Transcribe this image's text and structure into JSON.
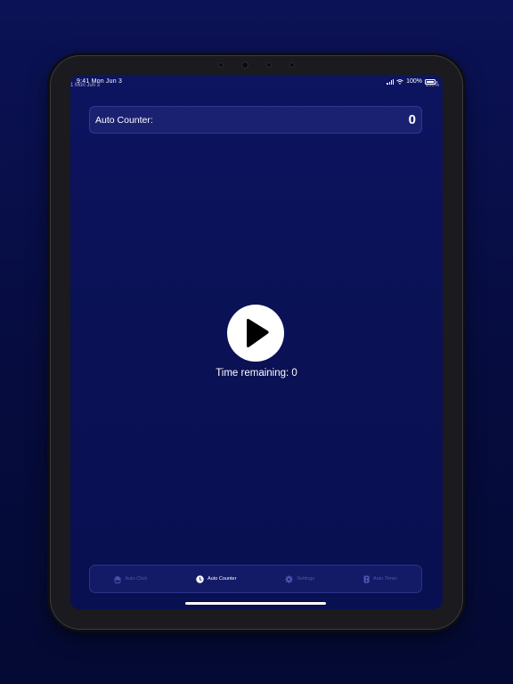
{
  "status_bar": {
    "time_date": "9:41 Mon Jun 3",
    "ghost_date": "1 Mon Jun 3",
    "battery": "100%"
  },
  "counter": {
    "label": "Auto Counter:",
    "value": "0"
  },
  "play": {
    "icon": "play-icon"
  },
  "timer": {
    "text": "Time remaining: 0"
  },
  "tabs": [
    {
      "label": "Auto Click",
      "icon": "hand-tap-icon",
      "active": false
    },
    {
      "label": "Auto Counter",
      "icon": "clock-icon",
      "active": true
    },
    {
      "label": "Settings",
      "icon": "gear-icon",
      "active": false
    },
    {
      "label": "Auto Timer",
      "icon": "hourglass-icon",
      "active": false
    }
  ],
  "colors": {
    "background": "#0b1256",
    "card": "#1a2170",
    "tab_inactive": "#4d57b3",
    "accent": "#ffffff"
  }
}
